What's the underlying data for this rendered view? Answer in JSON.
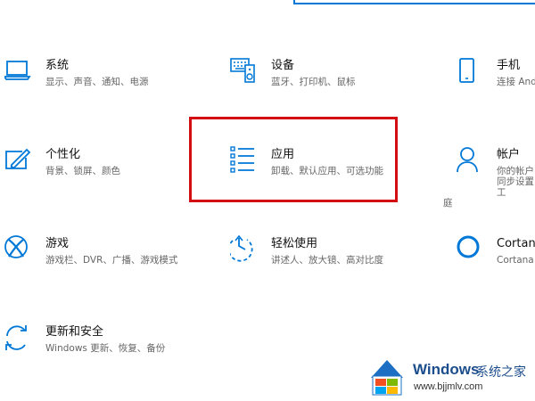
{
  "colors": {
    "accent": "#0078d7",
    "highlight": "#d40d12"
  },
  "tiles": [
    {
      "icon": "laptop-icon",
      "title": "系统",
      "desc": "显示、声音、通知、电源"
    },
    {
      "icon": "keyboard-speaker-icon",
      "title": "设备",
      "desc": "蓝牙、打印机、鼠标"
    },
    {
      "icon": "phone-icon",
      "title": "手机",
      "desc": "连接 Andr"
    },
    {
      "icon": "paint-pen-icon",
      "title": "个性化",
      "desc": "背景、锁屏、颜色"
    },
    {
      "icon": "apps-list-icon",
      "title": "应用",
      "desc": "卸载、默认应用、可选功能"
    },
    {
      "icon": "person-icon",
      "title": "帐户",
      "desc": [
        "你的帐户",
        "同步设置",
        "工",
        "庭"
      ]
    },
    {
      "icon": "xbox-icon",
      "title": "游戏",
      "desc": "游戏栏、DVR、广播、游戏模式"
    },
    {
      "icon": "ease-of-access-icon",
      "title": "轻松使用",
      "desc": "讲述人、放大镜、高对比度"
    },
    {
      "icon": "cortana-icon",
      "title": "Cortana",
      "desc": "Cortana 语"
    },
    {
      "icon": "update-sync-icon",
      "title": "更新和安全",
      "desc": "Windows 更新、恢复、备份"
    }
  ],
  "watermark": {
    "brand": "Windows",
    "sub": "系统之家",
    "url": "www.bjjmlv.com"
  }
}
